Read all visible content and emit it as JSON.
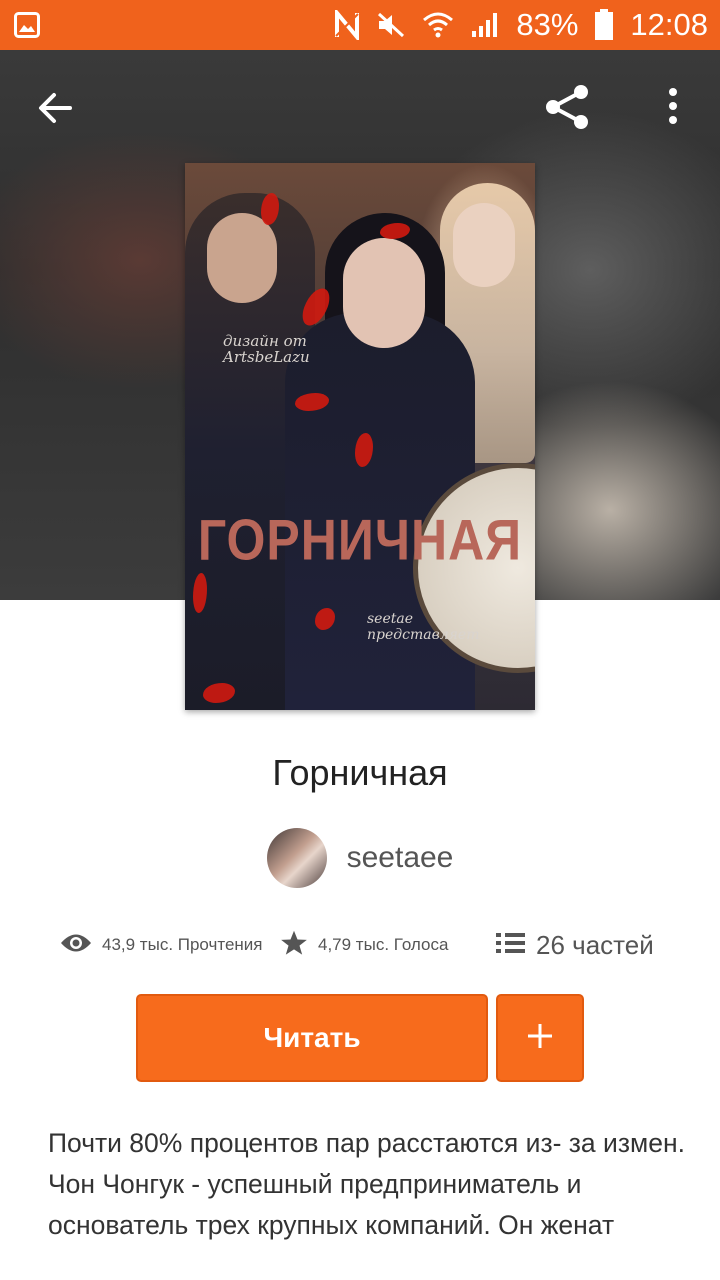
{
  "status_bar": {
    "battery": "83%",
    "time": "12:08"
  },
  "hero": {
    "cover": {
      "title": "ГОРНИЧНАЯ",
      "credit_top": "дизайн от\nArtsbeLazu",
      "credit_bottom": "seetae\nпредставляет"
    }
  },
  "story": {
    "title": "Горничная",
    "author": "seetaee"
  },
  "stats": {
    "reads": "43,9 тыс. Прочтения",
    "votes": "4,79 тыс. Голоса",
    "parts": "26 частей"
  },
  "actions": {
    "read_label": "Читать",
    "add_label": "+"
  },
  "description": {
    "line1": "Почти 80% процентов пар расстаются из- за измен.",
    "line2": "Чон Чонгук - успешный предприниматель и основатель трех крупных компаний. Он женат"
  },
  "colors": {
    "accent": "#f76b1c",
    "status_bar": "#f0621c"
  }
}
